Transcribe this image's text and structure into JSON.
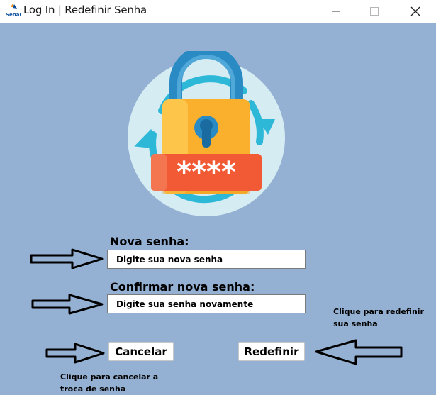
{
  "window": {
    "title": "Log In | Redefinir Senha",
    "logo_text": "SenaC",
    "icons": [
      "minimize-icon",
      "maximize-icon",
      "close-icon"
    ]
  },
  "illustration": {
    "icon": "padlock-reset-icon",
    "masked_password": "****"
  },
  "form": {
    "new_password_label": "Nova senha:",
    "new_password_placeholder": "Digite sua nova senha",
    "confirm_password_label": "Confirmar nova senha:",
    "confirm_password_placeholder": "Digite sua senha novamente"
  },
  "buttons": {
    "cancel": "Cancelar",
    "reset": "Redefinir"
  },
  "hints": {
    "reset_line1": "Clique para redefinir",
    "reset_line2": "sua senha",
    "cancel_line1": "Clique para cancelar a",
    "cancel_line2": "troca de senha"
  },
  "colors": {
    "background": "#94b1d3",
    "lock_body": "#fbb02d",
    "lock_shackle": "#2e8dc8",
    "password_bar": "#f15a35",
    "cycle_arrows": "#2eb8d8"
  }
}
